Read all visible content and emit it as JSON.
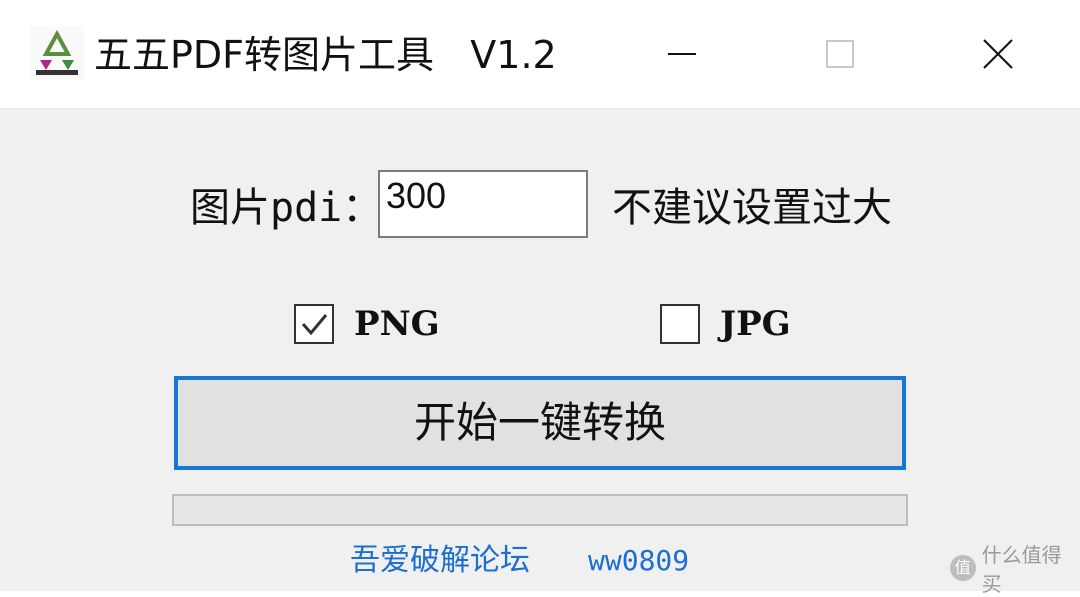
{
  "window": {
    "title": "五五PDF转图片工具   V1.2",
    "icon": "app-logo-icon",
    "controls": {
      "minimize_icon": "minimize-icon",
      "maximize_icon": "maximize-icon",
      "close_icon": "close-icon"
    }
  },
  "form": {
    "dpi_label": "图片pdi：",
    "dpi_value": "300",
    "dpi_hint": "不建议设置过大"
  },
  "formats": [
    {
      "label": "PNG",
      "checked": true
    },
    {
      "label": "JPG",
      "checked": false
    }
  ],
  "convert_button": "开始一键转换",
  "progress": {
    "value": 0
  },
  "footer": {
    "forum_link": "吾爱破解论坛",
    "user_link": "ww0809"
  },
  "watermark": {
    "logo_glyph": "值",
    "text": "什么值得买"
  },
  "colors": {
    "accent": "#1478d4",
    "link": "#1a6fd1",
    "window_bg": "#f0f0f0",
    "titlebar_bg": "#ffffff"
  }
}
